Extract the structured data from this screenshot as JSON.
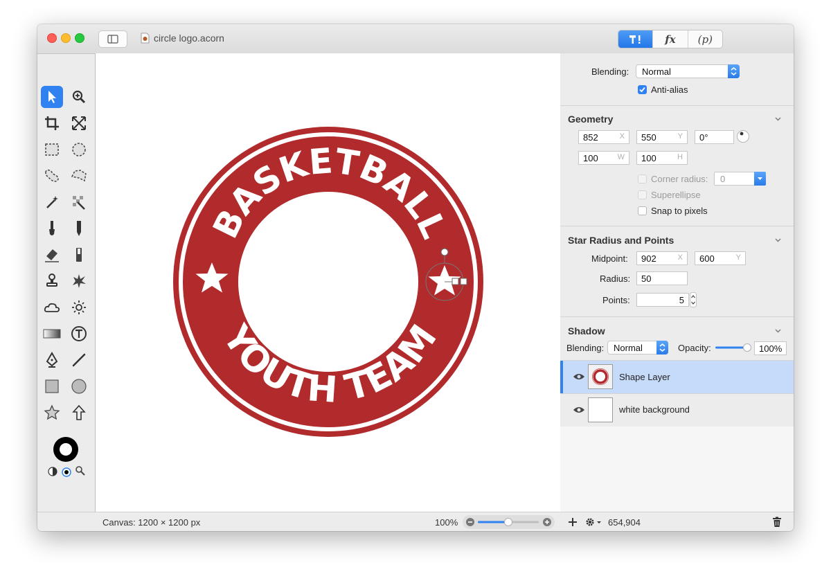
{
  "window": {
    "title": "circle logo.acorn"
  },
  "toolbar": {
    "segments": [
      "fx",
      "(p)"
    ]
  },
  "canvas": {
    "size_label": "Canvas: 1200 × 1200 px",
    "zoom": "100%",
    "logo": {
      "top_text": "BASKETBALL",
      "bottom_text": "YOUTH TEAM",
      "color": "#b12a2c"
    }
  },
  "panel": {
    "blending": {
      "label": "Blending:",
      "value": "Normal"
    },
    "antialias": {
      "label": "Anti-alias",
      "checked": true
    },
    "geometry": {
      "title": "Geometry",
      "x": "852",
      "x_unit": "X",
      "y": "550",
      "y_unit": "Y",
      "angle": "0°",
      "w": "100",
      "w_unit": "W",
      "h": "100",
      "h_unit": "H",
      "corner_radius": {
        "label": "Corner radius:",
        "value": "0"
      },
      "superellipse": "Superellipse",
      "snap": "Snap to pixels"
    },
    "star": {
      "title": "Star Radius and Points",
      "midpoint_label": "Midpoint:",
      "mid_x": "902",
      "mid_x_unit": "X",
      "mid_y": "600",
      "mid_y_unit": "Y",
      "radius_label": "Radius:",
      "radius": "50",
      "points_label": "Points:",
      "points": "5"
    },
    "shadow": {
      "title": "Shadow",
      "blending_label": "Blending:",
      "blending": "Normal",
      "opacity_label": "Opacity:",
      "opacity": "100%",
      "opacity_level": 1.0
    },
    "layers": [
      {
        "name": "Shape Layer",
        "selected": true
      },
      {
        "name": "white background",
        "selected": false
      }
    ]
  },
  "status": {
    "coords": "654,904"
  },
  "colors": {
    "accent": "#2f82f0",
    "selection": "#c6dafa",
    "logo_red": "#b12a2c"
  }
}
